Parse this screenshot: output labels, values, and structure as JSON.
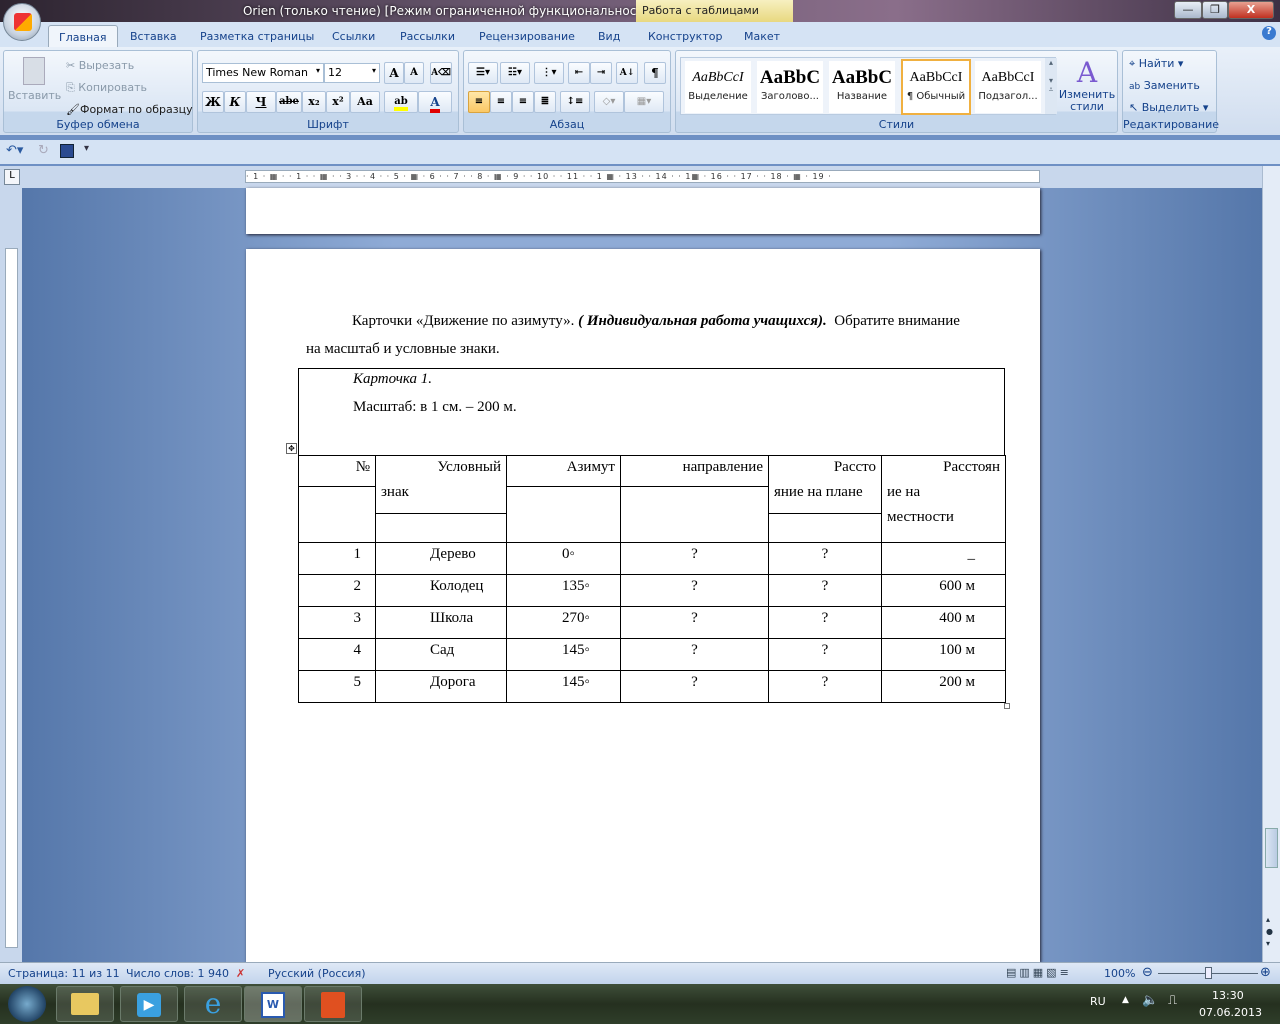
{
  "window": {
    "title": "Orien (только чтение) [Режим ограниченной функциональности] - Microsoft Word",
    "context_tab": "Работа с таблицами"
  },
  "tabs": [
    "Главная",
    "Вставка",
    "Разметка страницы",
    "Ссылки",
    "Рассылки",
    "Рецензирование",
    "Вид",
    "Конструктор",
    "Макет"
  ],
  "ribbon": {
    "clipboard": {
      "label": "Буфер обмена",
      "paste": "Вставить",
      "cut": "Вырезать",
      "copy": "Копировать",
      "format_painter": "Формат по образцу"
    },
    "font": {
      "label": "Шрифт",
      "font_name": "Times New Roman",
      "font_size": "12",
      "bold": "Ж",
      "italic": "К",
      "underline": "Ч",
      "strike": "abe",
      "sub": "x₂",
      "sup": "x²",
      "case": "Aa",
      "grow": "A",
      "shrink": "A",
      "highlight_color": "#ffff00",
      "font_color": "#e00000"
    },
    "paragraph": {
      "label": "Абзац",
      "pilcrow": "¶"
    },
    "styles": {
      "label": "Стили",
      "items": [
        {
          "preview": "AaBbCcI",
          "name": "Выделение"
        },
        {
          "preview": "AaBbC",
          "name": "Заголово..."
        },
        {
          "preview": "AaBbC",
          "name": "Название"
        },
        {
          "preview": "AaBbCcI",
          "name": "¶ Обычный"
        },
        {
          "preview": "AaBbCcI",
          "name": "Подзагол..."
        }
      ],
      "selected": 3,
      "change_styles": "Изменить стили"
    },
    "editing": {
      "label": "Редактирование",
      "find": "Найти",
      "replace": "Заменить",
      "select": "Выделить"
    }
  },
  "ruler": "· 1 · ▦ · · 1 · · ▦ · · 3 · · 4 · · 5 · ▦ · 6 · · 7 · · 8 · ▦ · 9 · · 10 · · 11 · · 1 ▦ · 13 · · 14 · · 1▦ · 16 · · 17 · · 18 · ▦ · 19 ·",
  "document": {
    "intro_plain": "Карточки «Движение по азимуту». ",
    "intro_bold": "( Индивидуальная работа учащихся).",
    "intro_rest": "  Обратите внимание",
    "intro_line2": "на масштаб и условные знаки.",
    "card_title": "Карточка 1.",
    "scale": "Масштаб: в 1 см. – 200 м.",
    "headers": {
      "num": "№",
      "sign_1": "Условный",
      "sign_2": "знак",
      "azimuth": "Азимут",
      "direction": "направление",
      "plan_1": "Рассто",
      "plan_2": "яние на плане",
      "ground_1": "Расстоян",
      "ground_2": "ие на",
      "ground_3": "местности"
    },
    "rows": [
      [
        "1",
        "Дерево",
        "0◦",
        "?",
        "?",
        "_"
      ],
      [
        "2",
        "Колодец",
        "135◦",
        "?",
        "?",
        "600 м"
      ],
      [
        "3",
        "Школа",
        "270◦",
        "?",
        "?",
        "400 м"
      ],
      [
        "4",
        "Сад",
        "145◦",
        "?",
        "?",
        "100 м"
      ],
      [
        "5",
        "Дорога",
        "145◦",
        "?",
        "?",
        "200 м"
      ]
    ]
  },
  "status": {
    "page": "Страница: 11 из 11",
    "words": "Число слов: 1 940",
    "language": "Русский (Россия)",
    "zoom": "100%",
    "zoom_percent": 100
  },
  "taskbar": {
    "lang": "RU",
    "time": "13:30",
    "date": "07.06.2013"
  }
}
